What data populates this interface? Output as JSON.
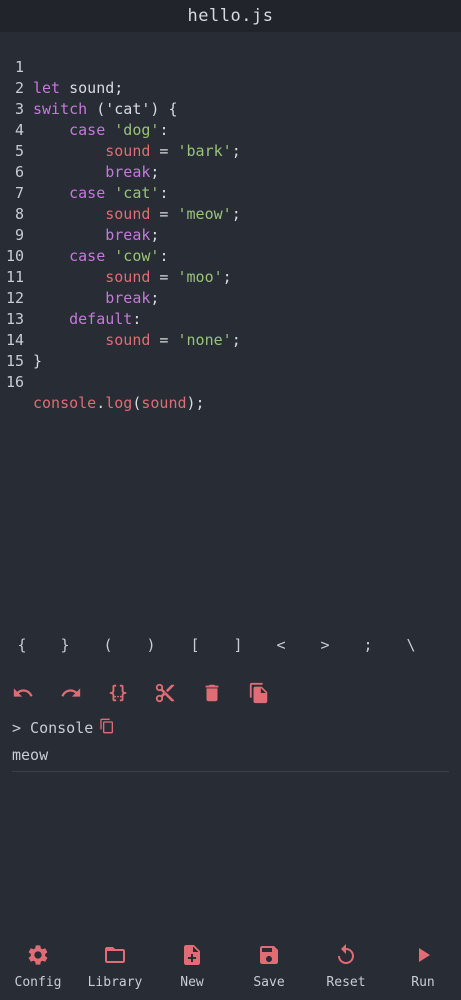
{
  "header": {
    "filename": "hello.js"
  },
  "editor": {
    "line_numbers": [
      "1",
      "2",
      "3",
      "4",
      "5",
      "6",
      "7",
      "8",
      "9",
      "10",
      "11",
      "12",
      "13",
      "14",
      "15",
      "16"
    ]
  },
  "symbols": [
    "{",
    "}",
    "(",
    ")",
    "[",
    "]",
    "<",
    ">",
    ";",
    "\\"
  ],
  "toolbar": {
    "undo_icon": "undo-icon",
    "redo_icon": "redo-icon",
    "format_icon": "braces-icon",
    "cut_icon": "scissors-icon",
    "delete_icon": "trash-icon",
    "copy_icon": "copy-icon"
  },
  "console": {
    "label": "> Console",
    "output": "meow"
  },
  "nav": {
    "config": "Config",
    "library": "Library",
    "new": "New",
    "save": "Save",
    "reset": "Reset",
    "run": "Run"
  },
  "colors": {
    "background": "#282c34",
    "accent": "#e06c75",
    "keyword": "#c678dd",
    "string": "#98c379"
  }
}
